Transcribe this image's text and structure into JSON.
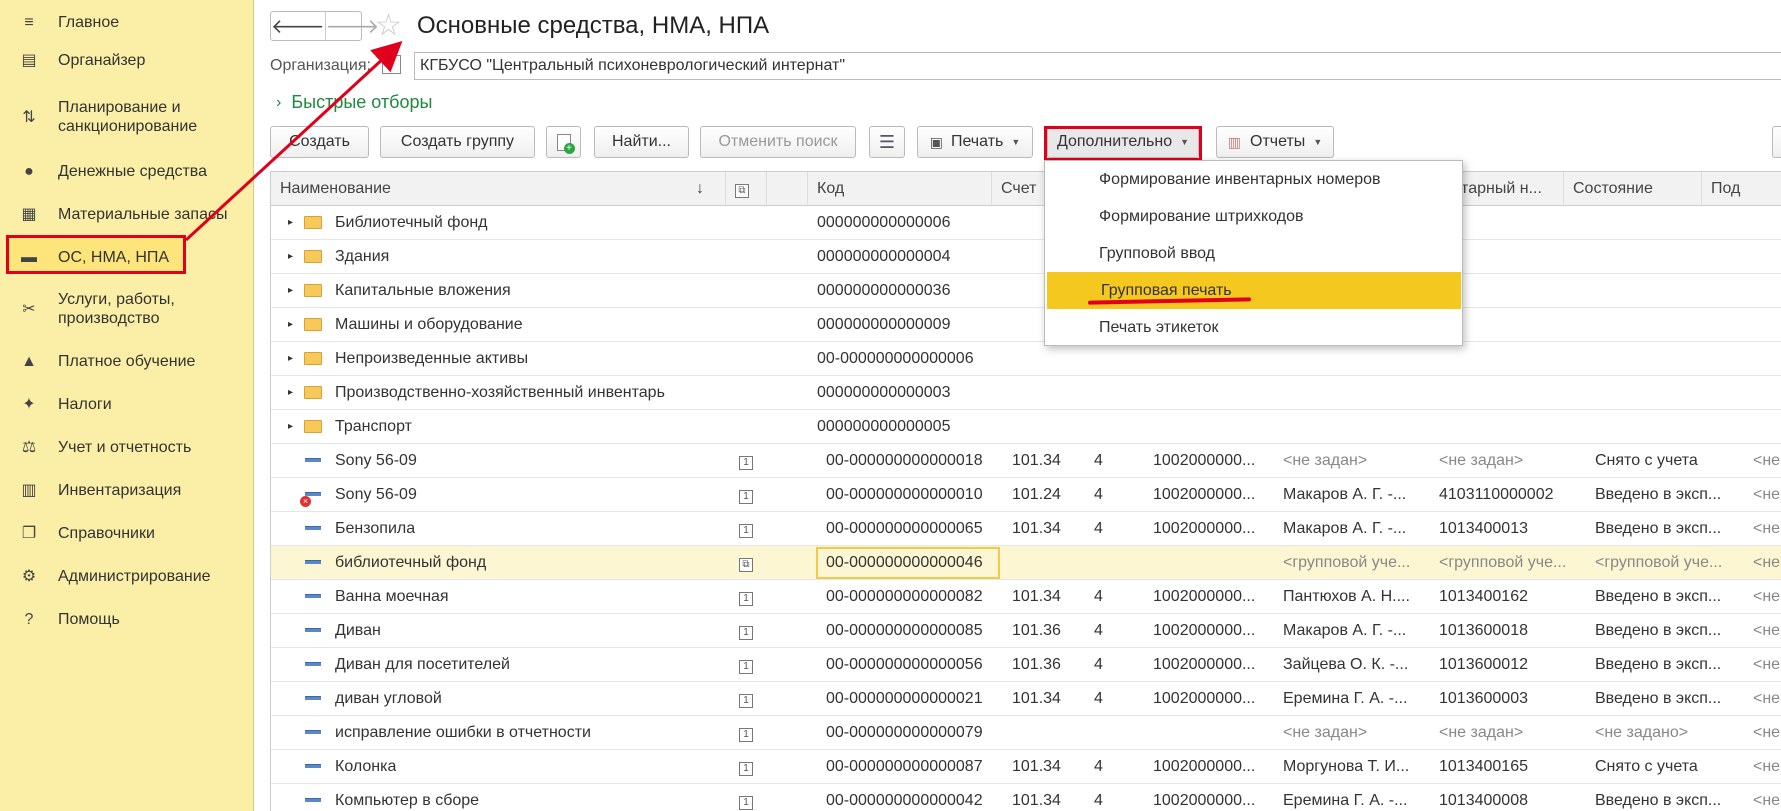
{
  "sidebar": {
    "items": [
      {
        "label": "Главное",
        "icon": "menu-icon"
      },
      {
        "label": "Органайзер",
        "icon": "organizer-icon"
      },
      {
        "label": "Планирование и санкционирование",
        "icon": "planning-icon"
      },
      {
        "label": "Денежные средства",
        "icon": "money-icon"
      },
      {
        "label": "Материальные запасы",
        "icon": "materials-icon"
      },
      {
        "label": "ОС, НМА, НПА",
        "icon": "truck-icon"
      },
      {
        "label": "Услуги, работы, производство",
        "icon": "tools-icon"
      },
      {
        "label": "Платное обучение",
        "icon": "graduation-icon"
      },
      {
        "label": "Налоги",
        "icon": "emblem-icon"
      },
      {
        "label": "Учет и отчетность",
        "icon": "accounting-icon"
      },
      {
        "label": "Инвентаризация",
        "icon": "inventory-icon"
      },
      {
        "label": "Справочники",
        "icon": "directory-icon"
      },
      {
        "label": "Администрирование",
        "icon": "gear-icon"
      },
      {
        "label": "Помощь",
        "icon": "help-icon"
      }
    ]
  },
  "header": {
    "title": "Основные средства, НМА, НПА",
    "org_label": "Организация:",
    "org_value": "КГБУСО \"Центральный психоневрологический интернат\"",
    "quick_filters": "Быстрые отборы"
  },
  "toolbar": {
    "create": "Создать",
    "create_group": "Создать группу",
    "find": "Найти...",
    "cancel_search": "Отменить поиск",
    "print": "Печать",
    "more": "Дополнительно",
    "reports": "Отчеты"
  },
  "menu": {
    "items": [
      "Формирование инвентарных номеров",
      "Формирование штрихкодов",
      "Групповой ввод",
      "Групповая печать",
      "Печать этикеток"
    ]
  },
  "table": {
    "columns": {
      "name": "Наименование",
      "sort": "↓",
      "code": "Код",
      "account": "Счет",
      "inventory": "вентарный н...",
      "state": "Состояние",
      "sub": "Под"
    },
    "folders": [
      {
        "name": "Библиотечный фонд",
        "code": "000000000000006"
      },
      {
        "name": "Здания",
        "code": "000000000000004"
      },
      {
        "name": "Капитальные вложения",
        "code": "000000000000036"
      },
      {
        "name": "Машины и оборудование",
        "code": "000000000000009"
      },
      {
        "name": "Непроизведенные активы",
        "code": "00-000000000000006"
      },
      {
        "name": "Производственно-хозяйственный инвентарь",
        "code": "000000000000003"
      },
      {
        "name": "Транспорт",
        "code": "000000000000005"
      }
    ],
    "items": [
      {
        "name": "Sony 56-09",
        "code": "00-000000000000018",
        "account": "101.34",
        "k": "4",
        "kps": "1002000000...",
        "resp": "<не задан>",
        "inv": "<не задан>",
        "state": "Снято с учета",
        "sub": "<не"
      },
      {
        "name": "Sony 56-09",
        "code": "00-000000000000010",
        "account": "101.24",
        "k": "4",
        "kps": "1002000000...",
        "resp": "Макаров А. Г. -...",
        "inv": "4103110000002",
        "state": "Введено в эксп...",
        "sub": "<не"
      },
      {
        "name": "Бензопила",
        "code": "00-000000000000065",
        "account": "101.34",
        "k": "4",
        "kps": "1002000000...",
        "resp": "Макаров А. Г. -...",
        "inv": "1013400013",
        "state": "Введено в эксп...",
        "sub": "<не"
      },
      {
        "name": "библиотечный фонд",
        "code": "00-000000000000046",
        "account": "",
        "k": "",
        "kps": "",
        "resp": "<групповой уче...",
        "inv": "<групповой уче...",
        "state": "<групповой уче...",
        "sub": "<не"
      },
      {
        "name": "Ванна моечная",
        "code": "00-000000000000082",
        "account": "101.34",
        "k": "4",
        "kps": "1002000000...",
        "resp": "Пантюхов А. Н....",
        "inv": "1013400162",
        "state": "Введено в эксп...",
        "sub": "<не"
      },
      {
        "name": "Диван",
        "code": "00-000000000000085",
        "account": "101.36",
        "k": "4",
        "kps": "1002000000...",
        "resp": "Макаров А. Г. -...",
        "inv": "1013600018",
        "state": "Введено в эксп...",
        "sub": "<не"
      },
      {
        "name": "Диван для посетителей",
        "code": "00-000000000000056",
        "account": "101.36",
        "k": "4",
        "kps": "1002000000...",
        "resp": "Зайцева О. К. -...",
        "inv": "1013600012",
        "state": "Введено в эксп...",
        "sub": "<не"
      },
      {
        "name": "диван угловой",
        "code": "00-000000000000021",
        "account": "101.34",
        "k": "4",
        "kps": "1002000000...",
        "resp": "Еремина Г. А. -...",
        "inv": "1013600003",
        "state": "Введено в эксп...",
        "sub": "<не"
      },
      {
        "name": "исправление ошибки в отчетности",
        "code": "00-000000000000079",
        "account": "",
        "k": "",
        "kps": "",
        "resp": "<не задан>",
        "inv": "<не задан>",
        "state": "<не задано>",
        "sub": "<не"
      },
      {
        "name": "Колонка",
        "code": "00-000000000000087",
        "account": "101.34",
        "k": "4",
        "kps": "1002000000...",
        "resp": "Моргунова Т. И...",
        "inv": "1013400165",
        "state": "Снято с учета",
        "sub": "<не"
      },
      {
        "name": "Компьютер в сборе",
        "code": "00-000000000000042",
        "account": "101.34",
        "k": "4",
        "kps": "1002000000...",
        "resp": "Еремина Г. А. -...",
        "inv": "1013400008",
        "state": "Введено в эксп...",
        "sub": "<не"
      }
    ]
  },
  "colors": {
    "sidebar_bg": "#fbeea6",
    "highlight": "#f5c81f",
    "annotation_red": "#e0001b",
    "quick_filters_green": "#1d8a3d"
  }
}
